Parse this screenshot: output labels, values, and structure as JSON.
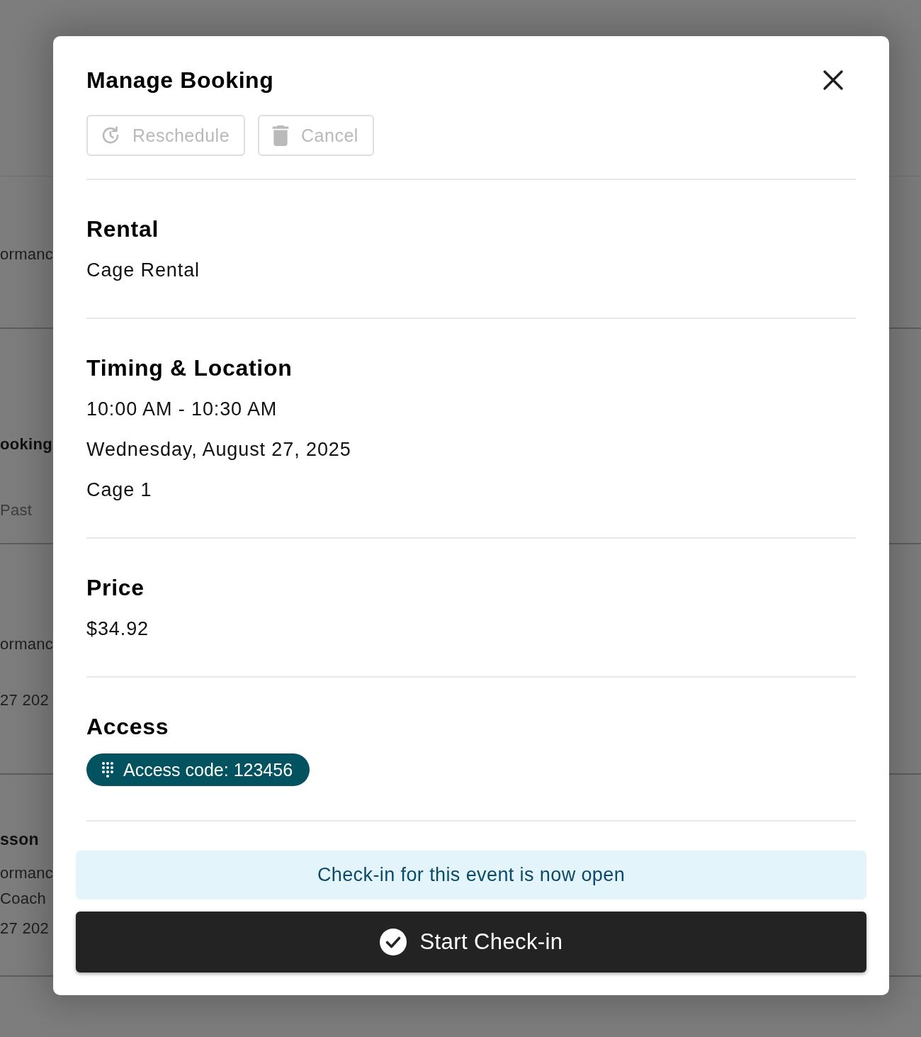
{
  "backdrop": {
    "rows": [
      {
        "lines": [
          {
            "kind": "detail",
            "text": "ormanc"
          }
        ]
      },
      {
        "lines": [
          {
            "kind": "heading",
            "text": "ooking"
          },
          {
            "kind": "tab",
            "text": "Past"
          }
        ]
      },
      {
        "lines": [
          {
            "kind": "detail",
            "text": "ormanc"
          },
          {
            "kind": "detail",
            "text": "27 202"
          }
        ]
      },
      {
        "lines": [
          {
            "kind": "title",
            "text": "sson"
          },
          {
            "kind": "detail",
            "text": "ormanc"
          },
          {
            "kind": "detail",
            "text": "Coach"
          },
          {
            "kind": "detail",
            "text": "27 202"
          }
        ]
      }
    ]
  },
  "dialog": {
    "title": "Manage Booking",
    "actions": [
      {
        "kind": "reschedule",
        "label": "Reschedule",
        "disabled": true
      },
      {
        "kind": "delete",
        "label": "Cancel",
        "disabled": true
      }
    ],
    "sections": [
      {
        "heading": "Rental",
        "items": [
          {
            "kind": "text",
            "text": "Cage Rental"
          }
        ]
      },
      {
        "heading": "Timing & Location",
        "items": [
          {
            "kind": "text",
            "text": "10:00 AM - 10:30 AM"
          },
          {
            "kind": "text",
            "text": "Wednesday, August 27, 2025"
          },
          {
            "kind": "text",
            "text": "Cage 1"
          }
        ]
      },
      {
        "heading": "Price",
        "items": [
          {
            "kind": "text",
            "text": "$34.92"
          }
        ]
      },
      {
        "heading": "Access",
        "items": [
          {
            "kind": "badge",
            "text": "Access code: 123456"
          }
        ]
      }
    ],
    "notice": "Check-in for this event is now open",
    "primary_button": {
      "label": "Start Check-in"
    }
  }
}
